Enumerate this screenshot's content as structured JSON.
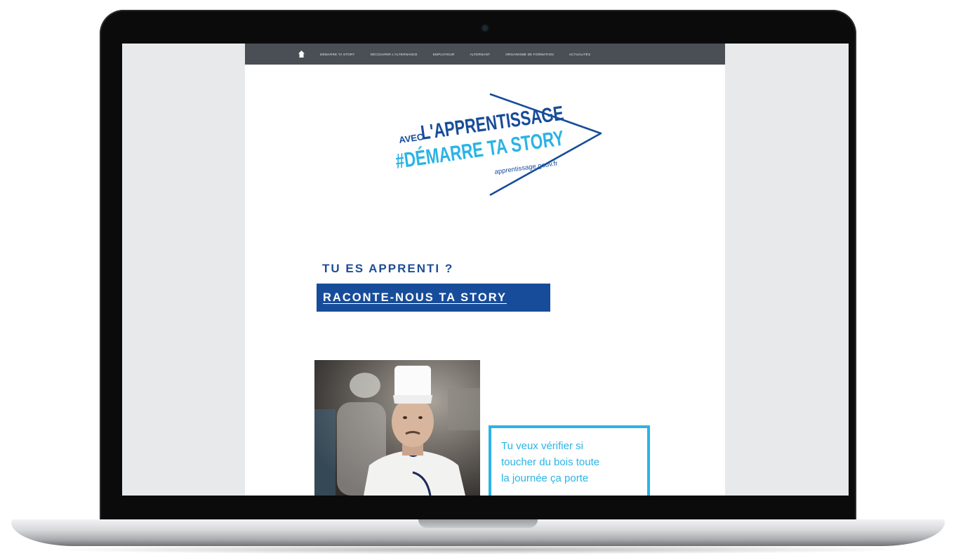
{
  "nav": {
    "home_icon": "house-icon",
    "items": [
      {
        "label": "DÉMARRE TA STORY"
      },
      {
        "label": "DÉCOUVRIR L'ALTERNANCE"
      },
      {
        "label": "EMPLOYEUR"
      },
      {
        "label": "ALTERNANT"
      },
      {
        "label": "ORGANISME DE FORMATION"
      },
      {
        "label": "ACTUALITÉS"
      }
    ]
  },
  "logo": {
    "avec": "AVEC",
    "line1": "L'APPRENTISSAGE",
    "line2": "#DÉMARRE TA STORY",
    "url": "apprentissage.gouv.fr"
  },
  "hero": {
    "subtitle": "TU ES APPRENTI ?",
    "cta": "RACONTE-NOUS TA STORY"
  },
  "card": {
    "quote_line1": "Tu veux vérifier si",
    "quote_line2": "toucher du bois toute",
    "quote_line3": "la journée ça porte"
  },
  "colors": {
    "nav_bg": "#4a4e55",
    "brand_blue": "#174c9a",
    "accent_cyan": "#2bb3e6"
  }
}
